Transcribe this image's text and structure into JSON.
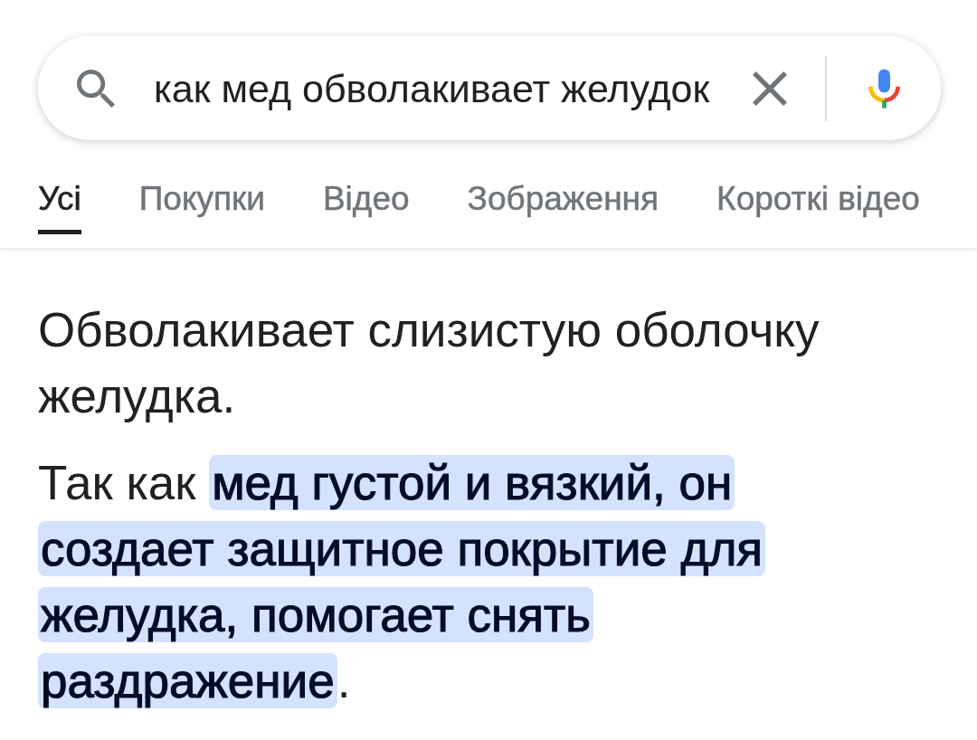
{
  "search": {
    "value": "как мед обволакивает желудок"
  },
  "tabs": [
    {
      "label": "Усі",
      "selected": true
    },
    {
      "label": "Покупки",
      "selected": false
    },
    {
      "label": "Відео",
      "selected": false
    },
    {
      "label": "Зображення",
      "selected": false
    },
    {
      "label": "Короткі відео",
      "selected": false
    }
  ],
  "answer": {
    "paragraphs": [
      "Обволакивает слизистую оболочку желудка.",
      "Так как **мед густой и вязкий, он создает защитное покрытие для желудка, помогает снять раздражение**."
    ]
  }
}
